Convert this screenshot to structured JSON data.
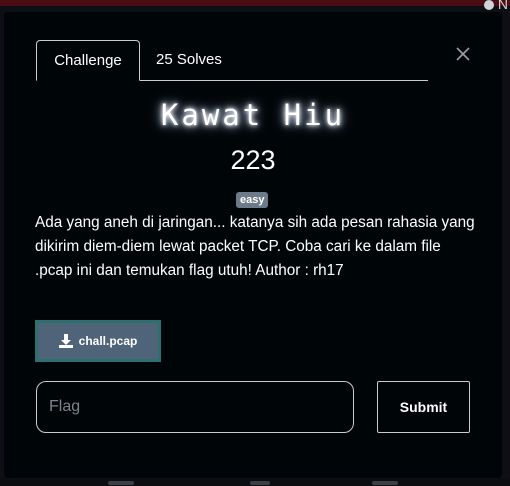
{
  "backdrop": {
    "user_label": "N"
  },
  "modal": {
    "tabs": [
      {
        "label": "Challenge",
        "active": true
      },
      {
        "label": "25 Solves",
        "active": false
      }
    ],
    "close_icon": "close-icon"
  },
  "challenge": {
    "name": "Kawat Hiu",
    "points": "223",
    "difficulty_tag": "easy",
    "description": "Ada yang aneh di jaringan... katanya sih ada pesan rahasia yang\ndikirim diem-diem lewat packet TCP. Coba cari ke dalam file\n.pcap ini dan temukan flag utuh! Author : rh17",
    "file": {
      "name": "chall.pcap",
      "icon": "download-icon"
    }
  },
  "submission": {
    "flag_placeholder": "Flag",
    "flag_value": "",
    "submit_label": "Submit"
  },
  "colors": {
    "modal_bg": "#000508",
    "download_bg": "#4f6379",
    "download_border": "#2c7070",
    "tag_bg": "#6c7a8a",
    "accent_top": "#4a0d12"
  }
}
